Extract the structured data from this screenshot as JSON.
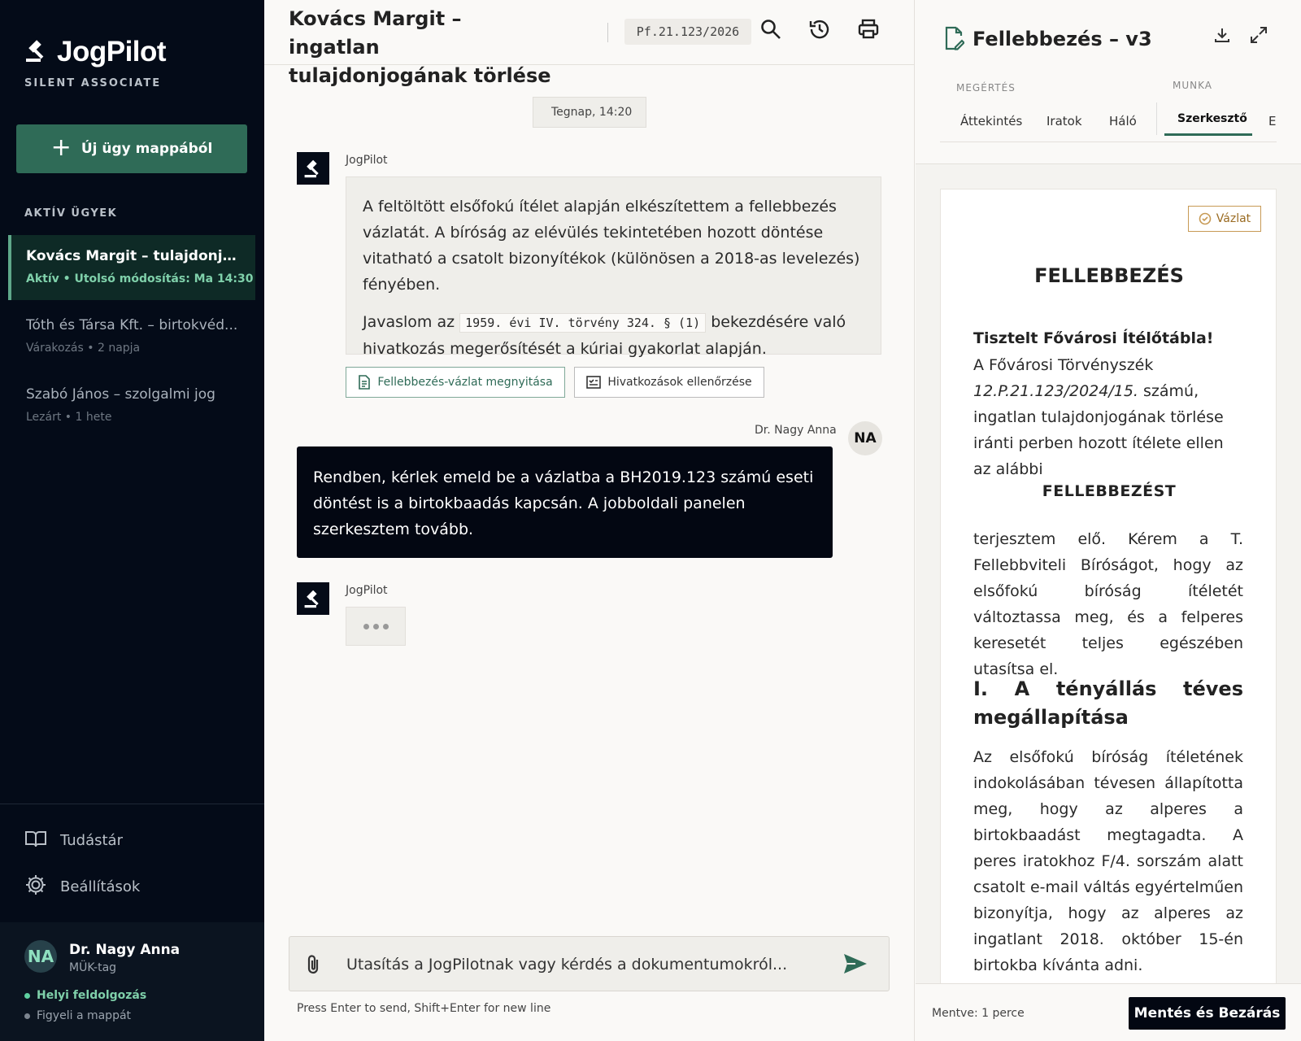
{
  "brand": {
    "name": "JogPilot",
    "tagline": "SILENT ASSOCIATE"
  },
  "sidebar": {
    "new_case_label": "Új ügy mappából",
    "section_label": "AKTÍV ÜGYEK",
    "cases": [
      {
        "title": "Kovács Margit – tulajdonjog tö...",
        "meta": "Aktív • Utolsó módosítás: Ma 14:30",
        "active": true
      },
      {
        "title": "Tóth és Társa Kft. – birtokvéd...",
        "meta": "Várakozás • 2 napja",
        "active": false
      },
      {
        "title": "Szabó János – szolgalmi jog",
        "meta": "Lezárt • 1 hete",
        "active": false
      }
    ],
    "nav": [
      {
        "label": "Tudástár",
        "icon": "book-icon"
      },
      {
        "label": "Beállítások",
        "icon": "gear-icon"
      }
    ],
    "user": {
      "initials": "NA",
      "name": "Dr. Nagy Anna",
      "role": "MÜK-tag",
      "status_primary": "Helyi feldolgozás",
      "status_secondary": "Figyeli a mappát"
    }
  },
  "main": {
    "title": "Kovács Margit – ingatlan tulajdonjogának törlése",
    "case_number": "Pf.21.123/2026",
    "date_chip": "Tegnap, 14:20",
    "bot_name": "JogPilot",
    "bot_message": {
      "p1": "A feltöltött elsőfokú ítélet alapján elkészítettem a fellebbezés vázlatát. A bíróság az elévülés tekintetében hozott döntése vitatható a csatolt bizonyítékok (különösen a 2018-as levelezés) fényében.",
      "p2_before": "Javaslom az",
      "p2_code": "1959. évi IV. törvény 324. § (1)",
      "p2_after": "bekezdésére való hivatkozás megerősítését a kúriai gyakorlat alapján."
    },
    "actions": {
      "open_draft": "Fellebbezés-vázlat megnyitása",
      "check_refs": "Hivatkozások ellenőrzése"
    },
    "user_name": "Dr. Nagy Anna",
    "user_initials": "NA",
    "user_message": "Rendben, kérlek emeld be a vázlatba a BH2019.123 számú eseti döntést is a birtokbaadás kapcsán. A jobboldali panelen szerkesztem tovább.",
    "bot_name_2": "JogPilot",
    "composer_placeholder": "Utasítás a JogPilotnak vagy kérdés a dokumentumokról...",
    "hint": "Press Enter to send, Shift+Enter for new line"
  },
  "panel": {
    "title": "Fellebbezés – v3",
    "group_understanding": "MEGÉRTÉS",
    "group_work": "MUNKA",
    "tabs": [
      "Áttekintés",
      "Iratok",
      "Háló",
      "Szerkesztő",
      "E"
    ],
    "active_tab": "Szerkesztő",
    "doc": {
      "badge": "Vázlat",
      "title": "FELLEBBEZÉS",
      "address": "Tisztelt Fővárosi Ítélőtábla!",
      "intro_before": "A Fővárosi Törvényszék",
      "intro_ref": "12.P.21.123/2024/15.",
      "intro_after": "számú, ingatlan tulajdonjogának törlése iránti perben hozott ítélete ellen az alábbi",
      "center_heading": "FELLEBBEZÉST",
      "request": "terjesztem elő. Kérem a T. Fellebbviteli Bíróságot, hogy az elsőfokú bíróság ítéletét változtassa meg, és a felperes keresetét teljes egészében utasítsa el.",
      "section_heading": "I. A tényállás téves megállapítása",
      "section_body": "Az elsőfokú bíróság ítéletének indokolásában tévesen állapította meg, hogy az alperes a birtokbaadást megtagadta. A peres iratokhoz F/4. sorszám alatt csatolt e-mail váltás egyértelműen bizonyítja, hogy az alperes az ingatlant 2018. október 15-én birtokba kívánta adni."
    },
    "saved": "Mentve: 1 perce",
    "save_close": "Mentés és Bezárás"
  },
  "colors": {
    "sidebar_bg": "#040b18",
    "accent_green": "#2f6b57",
    "active_meta": "#7fd0aa",
    "draft_badge": "#c79a55"
  }
}
